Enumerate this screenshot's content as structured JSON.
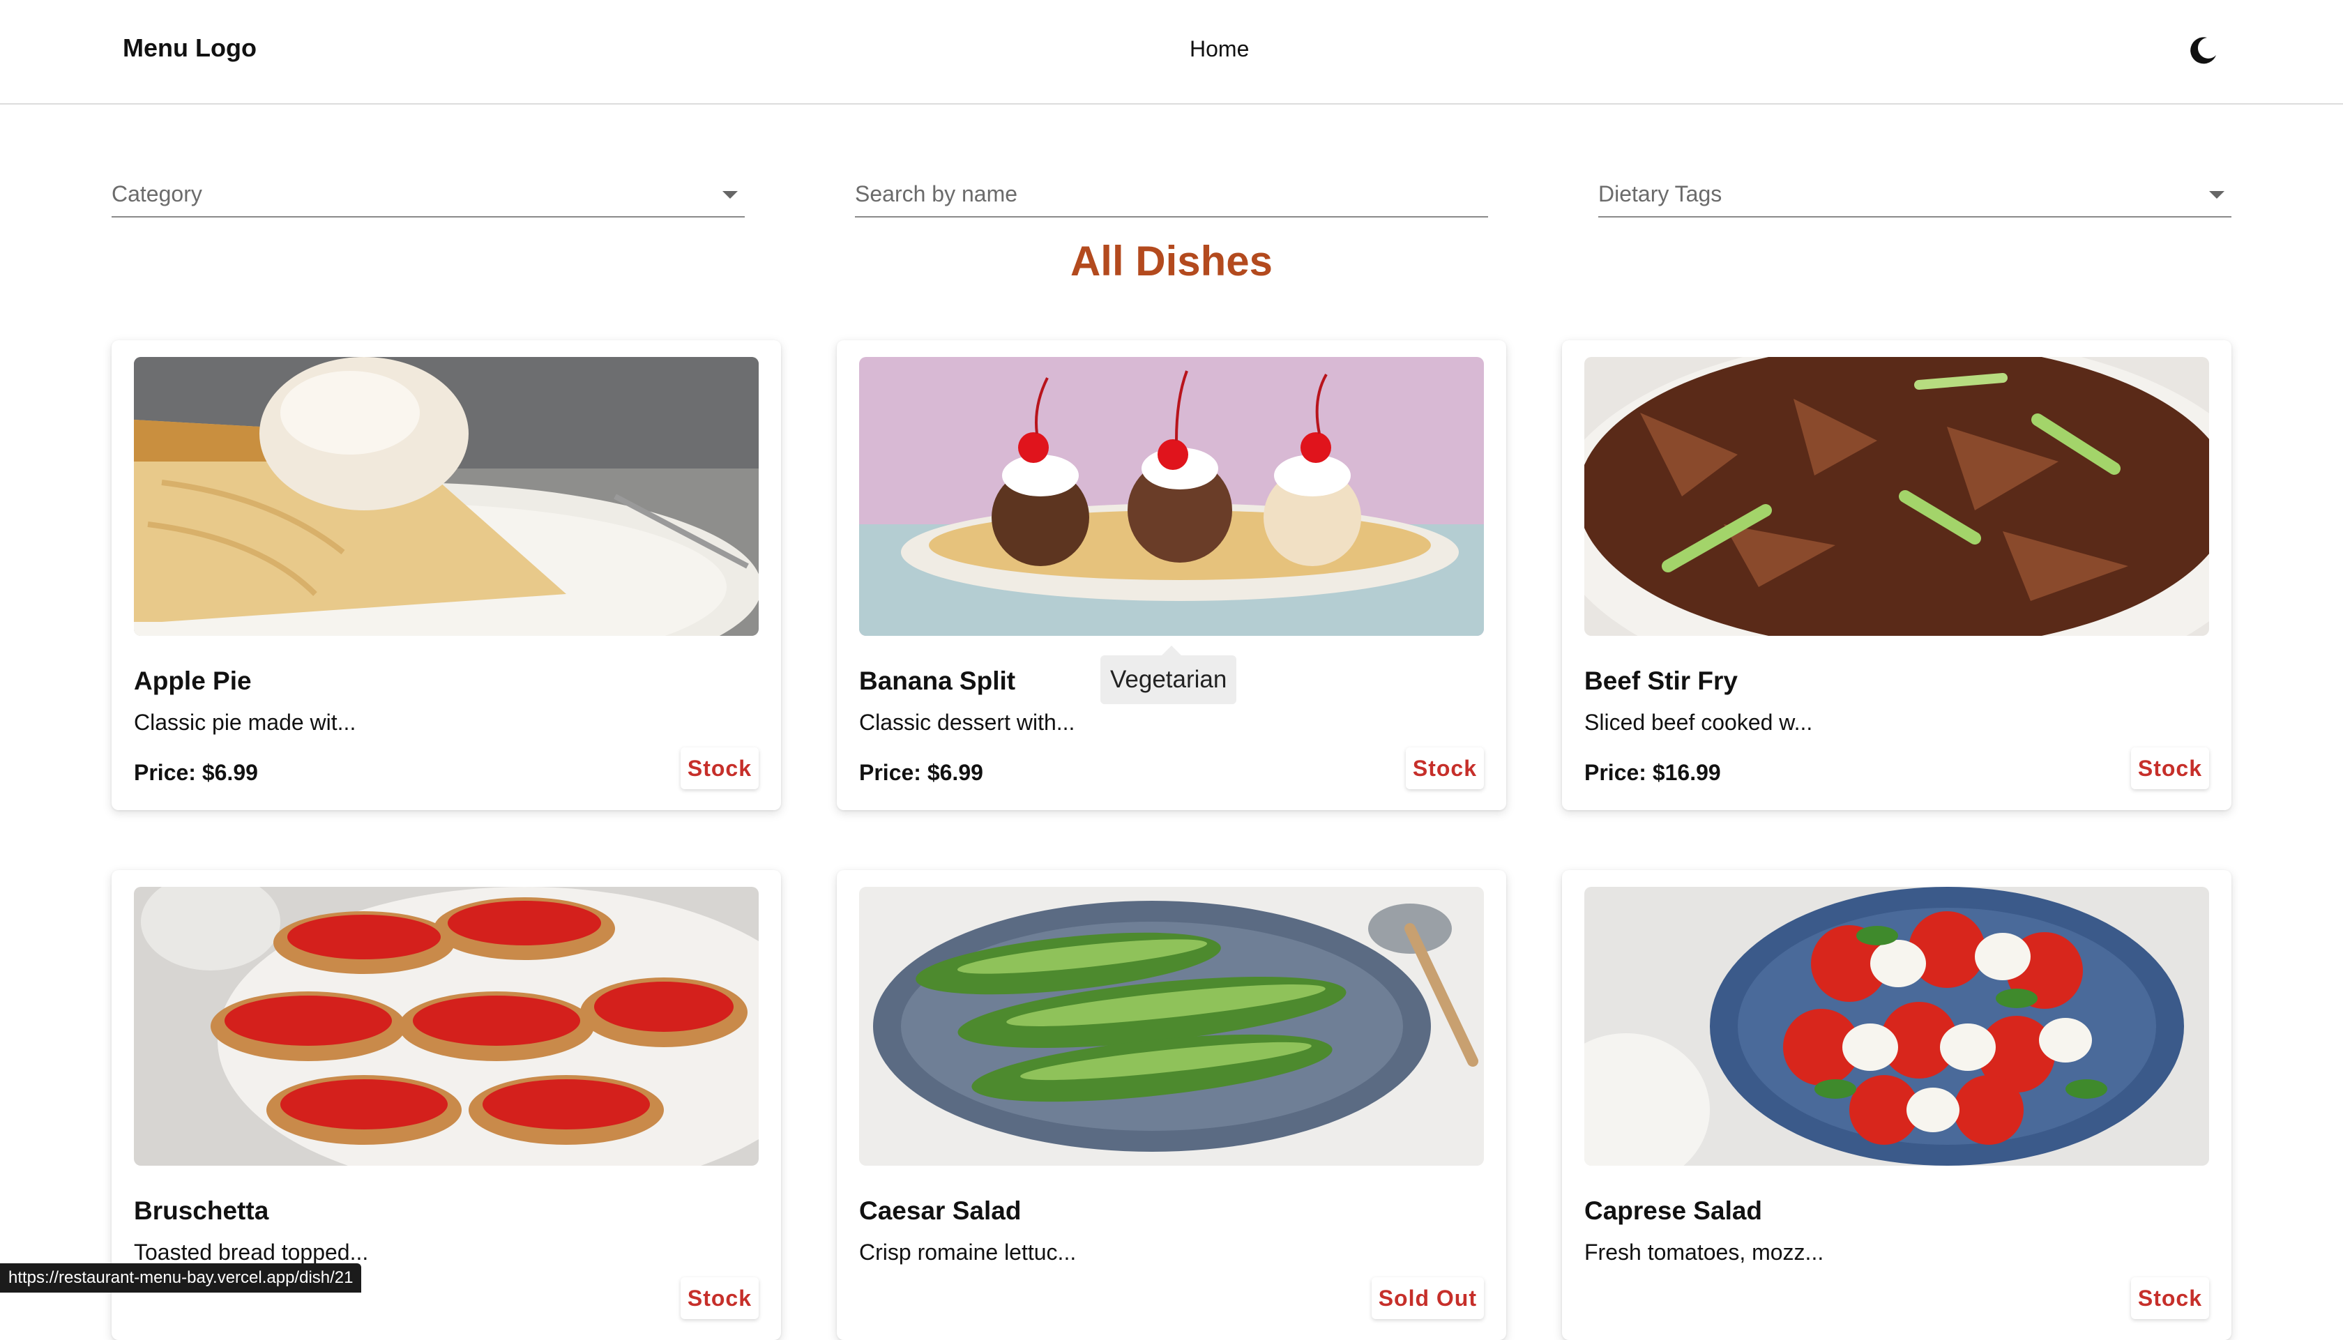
{
  "header": {
    "logo": "Menu Logo",
    "nav_home": "Home",
    "theme_icon": "moon-icon"
  },
  "filters": {
    "category": "Category",
    "search_placeholder": "Search by name",
    "dietary": "Dietary Tags"
  },
  "section_title": "All Dishes",
  "dishes": [
    {
      "name": "Apple Pie",
      "desc": "Classic pie made wit...",
      "price": "Price: $6.99",
      "stock": "Stock"
    },
    {
      "name": "Banana Split",
      "desc": "Classic dessert with...",
      "price": "Price: $6.99",
      "stock": "Stock"
    },
    {
      "name": "Beef Stir Fry",
      "desc": "Sliced beef cooked w...",
      "price": "Price: $16.99",
      "stock": "Stock"
    },
    {
      "name": "Bruschetta",
      "desc": "Toasted bread topped...",
      "price": "",
      "stock": "Stock"
    },
    {
      "name": "Caesar Salad",
      "desc": "Crisp romaine lettuc...",
      "price": "",
      "stock": "Sold Out"
    },
    {
      "name": "Caprese Salad",
      "desc": "Fresh tomatoes, mozz...",
      "price": "",
      "stock": "Stock"
    }
  ],
  "tooltip": "Vegetarian",
  "status_url": "https://restaurant-menu-bay.vercel.app/dish/21",
  "colors": {
    "accent_title": "#b34a1e",
    "stock_text": "#c62f2a"
  }
}
